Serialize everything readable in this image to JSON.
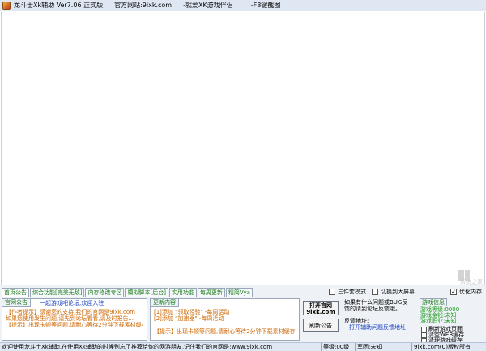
{
  "titlebar": {
    "title": "龙斗士Xk辅助 Ver7.06 正式版",
    "site": "官方网站:9ixk.com",
    "companion": "-就爱XK游戏伴侣",
    "shortcut": "-F8键截图"
  },
  "watermark": {
    "text": "系统之家"
  },
  "tabs": [
    {
      "label": "首页公告"
    },
    {
      "label": "综合功能[完美无敌]"
    },
    {
      "label": "内存修改专区"
    },
    {
      "label": "模拟脚本[后台]"
    },
    {
      "label": "实用功能"
    },
    {
      "label": "每周更新"
    },
    {
      "label": "精简Vya"
    }
  ],
  "checks": {
    "suit_mode": "三件套模式",
    "big_screen": "切换到大屏幕",
    "optimize_memory": "优化内存"
  },
  "announcement": {
    "group_title": "官网公告",
    "subtitle": "一起游戏吧论坛,欢迎入驻",
    "lines": [
      "【作者提示】感谢您的支持,我们的官网是9ixk.com",
      "如果您使用发生问题,请先到论坛看看,请及时报告...",
      "【提示】出现卡顿等问题,请耐心等待2分钟下载素材缓存即可。"
    ]
  },
  "updates": {
    "group_title": "更新内容",
    "lines": [
      "[1]添加 \"领取经验\" -每周活动",
      "[2]添加 \"加速器\" -每周活动",
      "【提示】出现卡顿等问题,请耐心等待2分钟下载素材缓存即可"
    ]
  },
  "buttons": {
    "open_site_line1": "打开官网",
    "open_site_line2": "9ixk.com",
    "refresh": "刷新公告"
  },
  "customer_service": {
    "line1": "如果有什么问题或BUG反",
    "line2": "馈的请到论坛反馈哦。",
    "feedback_label": "反馈地址:",
    "feedback_link": "打开辅助问题反馈地址"
  },
  "game_info": {
    "title": "游戏信息",
    "lines": [
      "游戏等级:0000",
      "游戏金钱:未知",
      "游戏职业:未知"
    ],
    "options": [
      "刷新游戏页面",
      "清空WEB缓存",
      "清理游戏缓存"
    ]
  },
  "statusbar": {
    "welcome": "欢迎使用龙斗士Xk辅助,在使用Xk辅助的时候别忘了推荐给你的网游朋友,记住我们的官网是:www.9ixk.com",
    "level": "等级:00级",
    "camp": "军团:未知",
    "copyright": "9ixk.com(C)版权所有"
  }
}
